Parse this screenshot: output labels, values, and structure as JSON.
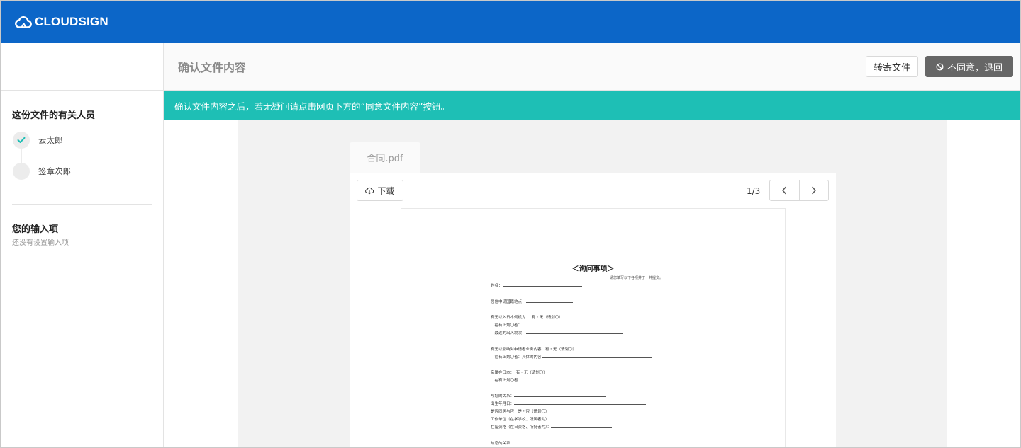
{
  "brand": {
    "name": "CLOUDSIGN"
  },
  "header": {
    "title": "确认文件内容",
    "forward_label": "转寄文件",
    "decline_label": "不同意，退回"
  },
  "sidebar": {
    "people_title": "这份文件的有关人员",
    "people": [
      {
        "name": "云太郎",
        "status": "done"
      },
      {
        "name": "签章次郎",
        "status": "pending"
      }
    ],
    "inputs_title": "您的输入项",
    "inputs_empty": "还没有设置输入项"
  },
  "notice": "确认文件内容之后，若无疑问请点击网页下方的“同意文件内容”按钮。",
  "viewer": {
    "file_name": "合同.pdf",
    "download_label": "下载",
    "page_indicator": "1/3"
  },
  "document": {
    "title": "＜询问事项＞",
    "note": "请您填写以下各项并于一并提交。",
    "lines": [
      "姓名：",
      "居住申请国籍地点：",
      "有无以入日本伺机为：　有・无（请划〇）",
      "　在有上划〇者：",
      "　最近的出入境次：",
      "有无以影响对申请者业务内容：有・无（请划〇）",
      "　在有上划〇者：具体的内容",
      "亲属在日本：　有・无（请划〇）",
      "　在有上划〇者：",
      "与您的关系：",
      "出生年月日：",
      "是否同居与否：是・否（请划〇）",
      "工作单位（在学学校、所属者为）：",
      "在留资格（在日资格、所持者为）：",
      "与您的关系："
    ]
  },
  "colors": {
    "topbar": "#0c66c8",
    "notice": "#1ebfb5",
    "decline_button": "#666666",
    "check": "#1ebfb5"
  }
}
